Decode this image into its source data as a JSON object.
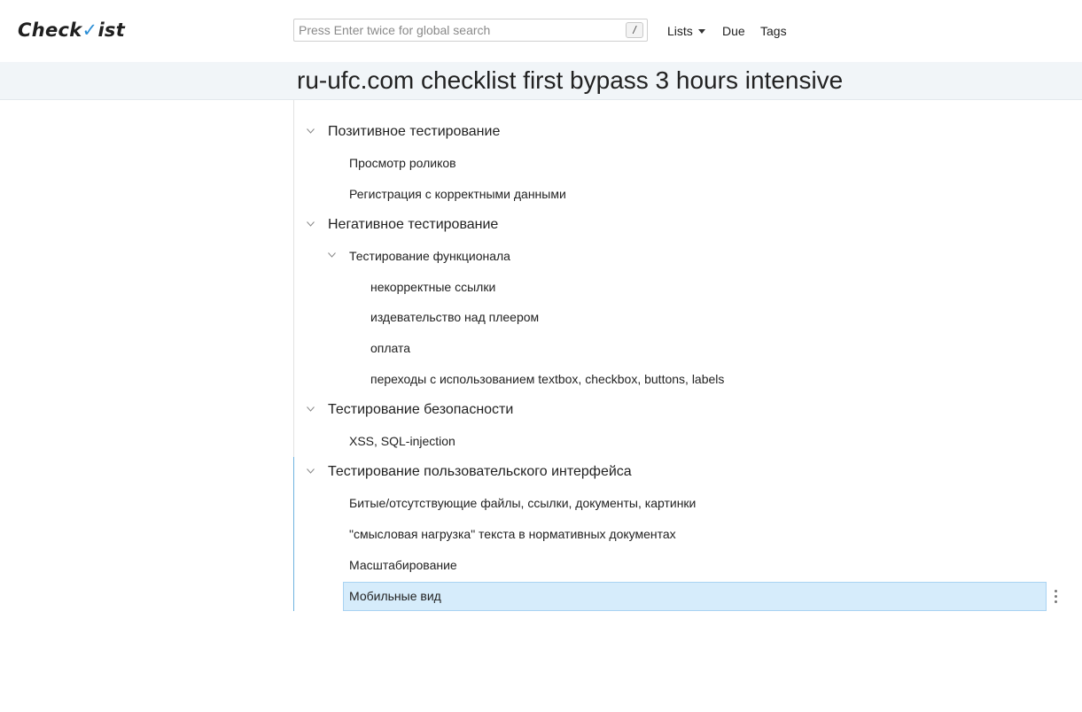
{
  "app": {
    "logo_text_a": "Check",
    "logo_text_b": "ist",
    "accent_color": "#2d8fd6"
  },
  "search": {
    "placeholder": "Press Enter twice for global search",
    "shortcut_key": "/"
  },
  "nav": {
    "lists": "Lists",
    "due": "Due",
    "tags": "Tags"
  },
  "page": {
    "title": "ru-ufc.com checklist first bypass 3 hours intensive"
  },
  "checklist": [
    {
      "level": 1,
      "label": "Позитивное тестирование",
      "expanded": true
    },
    {
      "level": 2,
      "label": "Просмотр роликов"
    },
    {
      "level": 2,
      "label": "Регистрация с корректными данными"
    },
    {
      "level": 1,
      "label": "Негативное тестирование",
      "expanded": true
    },
    {
      "level": 2,
      "label": "Тестирование функционала",
      "expanded": true
    },
    {
      "level": 3,
      "label": "некорректные ссылки"
    },
    {
      "level": 3,
      "label": "издевательство над плеером"
    },
    {
      "level": 3,
      "label": "оплата"
    },
    {
      "level": 3,
      "label": "переходы с использованием textbox, checkbox, buttons, labels"
    },
    {
      "level": 1,
      "label": "Тестирование безопасности",
      "expanded": true
    },
    {
      "level": 2,
      "label": "XSS, SQL-injection"
    },
    {
      "level": 1,
      "label": "Тестирование пользовательского интерфейса",
      "expanded": true
    },
    {
      "level": 2,
      "label": "Битые/отсутствующие файлы, ссылки, документы, картинки"
    },
    {
      "level": 2,
      "label": "\"смысловая нагрузка\" текста в нормативных документах"
    },
    {
      "level": 2,
      "label": "Масштабирование"
    },
    {
      "level": 2,
      "label": "Мобильные вид",
      "selected": true
    }
  ]
}
